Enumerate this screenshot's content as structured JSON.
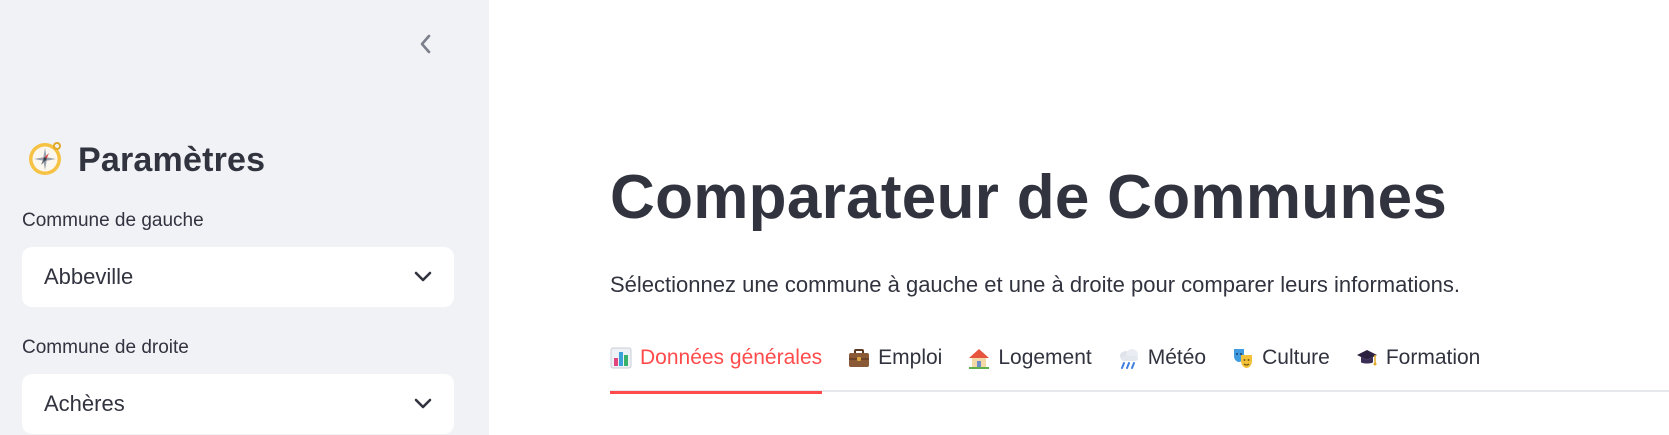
{
  "sidebar": {
    "title": "Paramètres",
    "title_icon": "compass-icon",
    "collapse_icon": "chevron-left-icon",
    "left_commune": {
      "label": "Commune de gauche",
      "value": "Abbeville"
    },
    "right_commune": {
      "label": "Commune de droite",
      "value": "Achères"
    }
  },
  "main": {
    "title": "Comparateur de Communes",
    "subtitle": "Sélectionnez une commune à gauche et une à droite pour comparer leurs informations.",
    "tabs": [
      {
        "label": "Données générales",
        "icon": "bar-chart-icon",
        "active": true
      },
      {
        "label": "Emploi",
        "icon": "briefcase-icon",
        "active": false
      },
      {
        "label": "Logement",
        "icon": "house-icon",
        "active": false
      },
      {
        "label": "Météo",
        "icon": "rain-cloud-icon",
        "active": false
      },
      {
        "label": "Culture",
        "icon": "theater-masks-icon",
        "active": false
      },
      {
        "label": "Formation",
        "icon": "graduation-cap-icon",
        "active": false
      }
    ]
  },
  "colors": {
    "sidebar_bg": "#f0f2f6",
    "text": "#31333f",
    "accent": "#ff4b4b"
  }
}
